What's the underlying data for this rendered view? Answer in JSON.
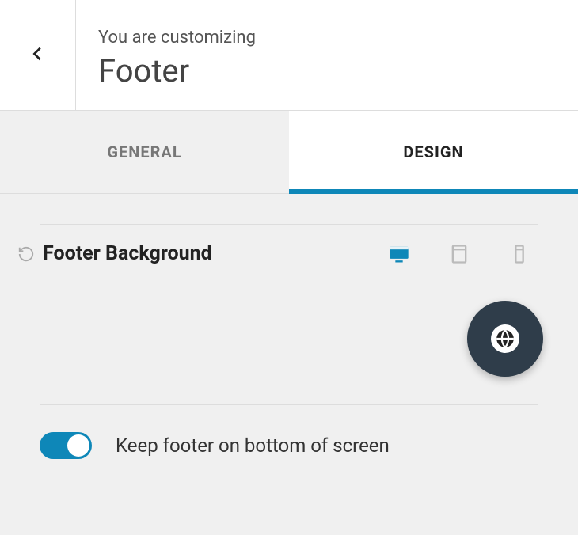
{
  "header": {
    "subtitle": "You are customizing",
    "title": "Footer"
  },
  "tabs": [
    {
      "label": "GENERAL",
      "active": false
    },
    {
      "label": "DESIGN",
      "active": true
    }
  ],
  "settings": {
    "background": {
      "label": "Footer Background",
      "devices": [
        "desktop",
        "tablet",
        "mobile"
      ],
      "active_device": "desktop"
    },
    "keep_bottom": {
      "label": "Keep footer on bottom of screen",
      "value": true
    }
  }
}
